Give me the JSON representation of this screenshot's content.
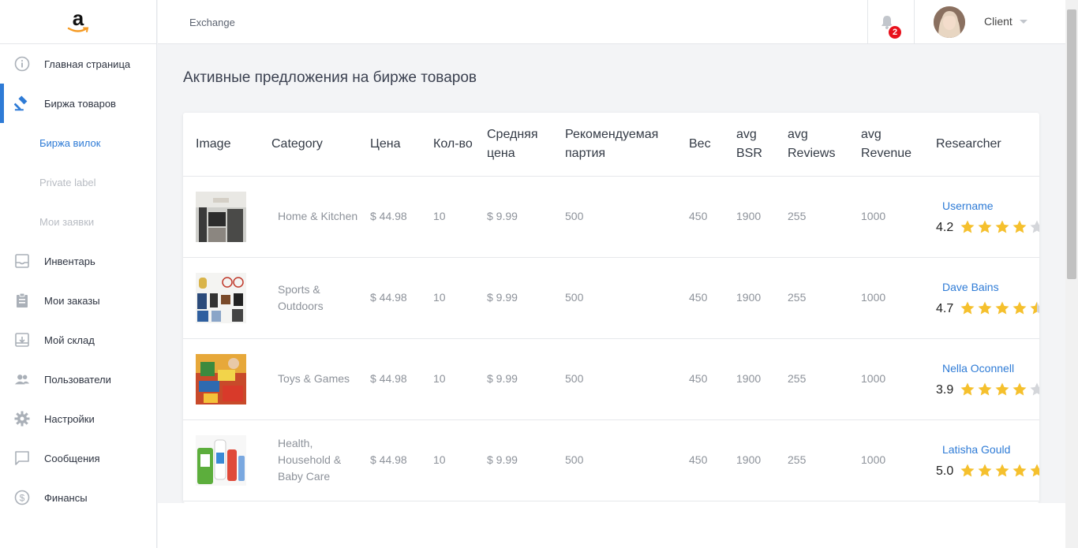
{
  "sidebar": {
    "logo_letter": "a",
    "items": [
      {
        "label": "Главная страница",
        "icon": "info-icon"
      },
      {
        "label": "Биржа товаров",
        "icon": "gavel-icon"
      },
      {
        "label": "Инвентарь",
        "icon": "inbox-icon"
      },
      {
        "label": "Мои заказы",
        "icon": "clipboard-icon"
      },
      {
        "label": "Мой склад",
        "icon": "archive-icon"
      },
      {
        "label": "Пользователи",
        "icon": "users-icon"
      },
      {
        "label": "Настройки",
        "icon": "gear-icon"
      },
      {
        "label": "Сообщения",
        "icon": "message-icon"
      },
      {
        "label": "Финансы",
        "icon": "dollar-icon"
      }
    ],
    "subitems": [
      "Биржа вилок",
      "Private label",
      "Мои заявки"
    ]
  },
  "header": {
    "breadcrumb": "Exchange",
    "notifications_count": "2",
    "user_name": "Client"
  },
  "main": {
    "title": "Активные предложения на бирже товаров",
    "columns": [
      "Image",
      "Category",
      "Цена",
      "Кол-во",
      "Средняя цена",
      "Рекомендуемая партия",
      "Вес",
      "avg BSR",
      "avg Reviews",
      "avg Revenue",
      "Researcher"
    ],
    "rows": [
      {
        "image": "kitchen",
        "category": "Home & Kitchen",
        "price": "$ 44.98",
        "qty": "10",
        "avg_price": "$ 9.99",
        "batch": "500",
        "weight": "450",
        "bsr": "1900",
        "reviews": "255",
        "revenue": "1000",
        "researcher": "Username",
        "rating": "4.2",
        "rating_value": 4.2
      },
      {
        "image": "sports",
        "category": "Sports & Outdoors",
        "price": "$ 44.98",
        "qty": "10",
        "avg_price": "$ 9.99",
        "batch": "500",
        "weight": "450",
        "bsr": "1900",
        "reviews": "255",
        "revenue": "1000",
        "researcher": "Dave Bains",
        "rating": "4.7",
        "rating_value": 4.7
      },
      {
        "image": "toys",
        "category": "Toys & Games",
        "price": "$ 44.98",
        "qty": "10",
        "avg_price": "$ 9.99",
        "batch": "500",
        "weight": "450",
        "bsr": "1900",
        "reviews": "255",
        "revenue": "1000",
        "researcher": "Nella Oconnell",
        "rating": "3.9",
        "rating_value": 3.9
      },
      {
        "image": "health",
        "category": "Health, Household & Baby Care",
        "price": "$ 44.98",
        "qty": "10",
        "avg_price": "$ 9.99",
        "batch": "500",
        "weight": "450",
        "bsr": "1900",
        "reviews": "255",
        "revenue": "1000",
        "researcher": "Latisha Gould",
        "rating": "5.0",
        "rating_value": 5.0
      }
    ]
  },
  "colors": {
    "accent": "#2e7bd6",
    "star_on": "#f5c02d",
    "star_off": "#d4d6da",
    "badge": "#e8111c"
  }
}
